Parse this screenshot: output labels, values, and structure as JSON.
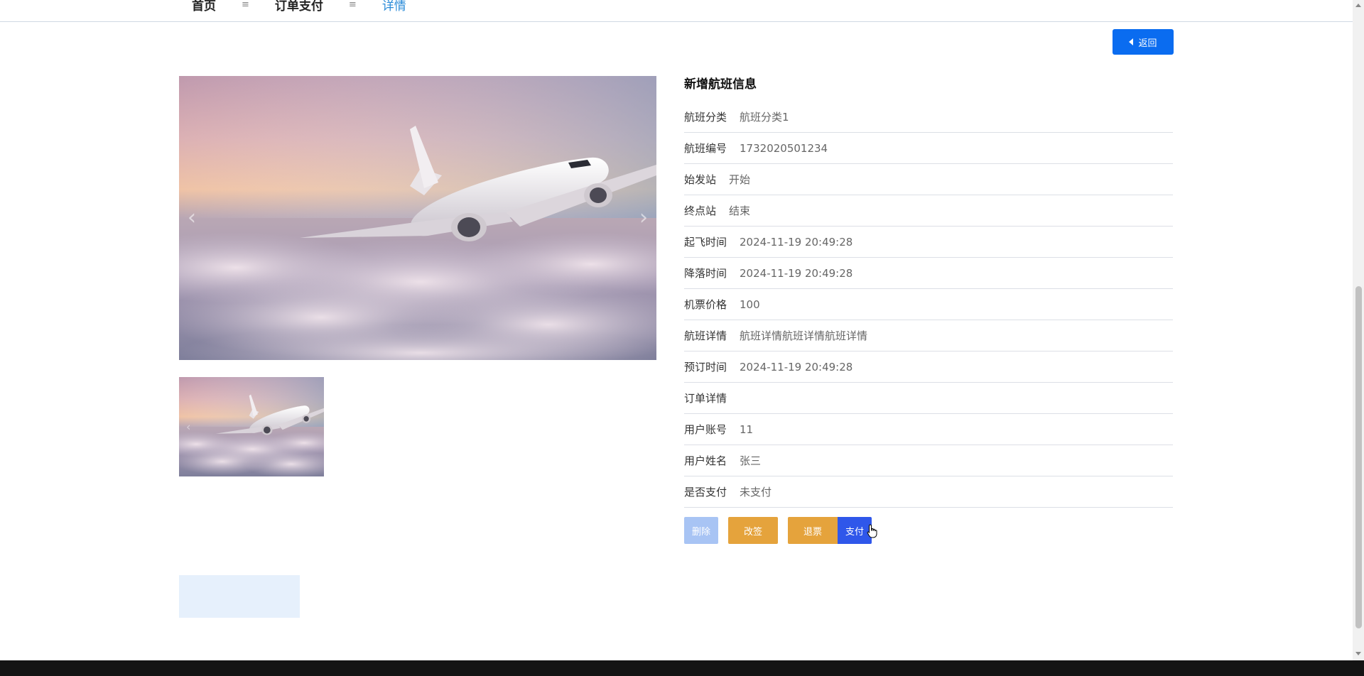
{
  "breadcrumb": {
    "items": [
      {
        "label": "首页"
      },
      {
        "label": "订单支付"
      },
      {
        "label": "详情"
      }
    ],
    "separator": "≡"
  },
  "back_button": {
    "label": "返回"
  },
  "carousel": {
    "prev": "‹",
    "next": "›",
    "thumb_prev": "‹"
  },
  "details": {
    "title": "新增航班信息",
    "rows": [
      {
        "label": "航班分类",
        "value": "航班分类1"
      },
      {
        "label": "航班编号",
        "value": "1732020501234"
      },
      {
        "label": "始发站",
        "value": "开始"
      },
      {
        "label": "终点站",
        "value": "结束"
      },
      {
        "label": "起飞时间",
        "value": "2024-11-19 20:49:28"
      },
      {
        "label": "降落时间",
        "value": "2024-11-19 20:49:28"
      },
      {
        "label": "机票价格",
        "value": "100"
      },
      {
        "label": "航班详情",
        "value": "航班详情航班详情航班详情"
      },
      {
        "label": "预订时间",
        "value": "2024-11-19 20:49:28"
      },
      {
        "label": "订单详情",
        "value": ""
      },
      {
        "label": "用户账号",
        "value": "11"
      },
      {
        "label": "用户姓名",
        "value": "张三"
      },
      {
        "label": "是否支付",
        "value": "未支付"
      }
    ]
  },
  "actions": {
    "delete": "删除",
    "change": "改签",
    "refund": "退票",
    "pay": "支付"
  },
  "colors": {
    "primary": "#0a6cf0",
    "orange": "#e5a33c",
    "pay": "#2f57ea",
    "delete_disabled": "#a8c4f4",
    "breadcrumb_active": "#2a8bd8"
  }
}
